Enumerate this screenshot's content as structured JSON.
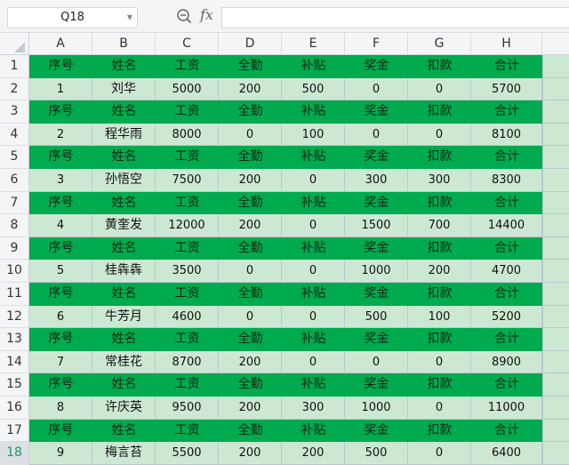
{
  "formula_bar": {
    "name_box": "Q18",
    "zoom_icon": "magnifier-zoom-icon",
    "fx_label": "fx",
    "formula_value": ""
  },
  "columns": [
    "A",
    "B",
    "C",
    "D",
    "E",
    "F",
    "G",
    "H"
  ],
  "row_numbers": [
    "1",
    "2",
    "3",
    "4",
    "5",
    "6",
    "7",
    "8",
    "9",
    "10",
    "11",
    "12",
    "13",
    "14",
    "15",
    "16",
    "17",
    "18"
  ],
  "active_row": "18",
  "header_labels": [
    "序号",
    "姓名",
    "工资",
    "全勤",
    "补贴",
    "奖金",
    "扣款",
    "合计"
  ],
  "records": [
    [
      "1",
      "刘华",
      "5000",
      "200",
      "500",
      "0",
      "0",
      "5700"
    ],
    [
      "2",
      "程华雨",
      "8000",
      "0",
      "100",
      "0",
      "0",
      "8100"
    ],
    [
      "3",
      "孙悟空",
      "7500",
      "200",
      "0",
      "300",
      "300",
      "8300"
    ],
    [
      "4",
      "黄奎发",
      "12000",
      "200",
      "0",
      "1500",
      "700",
      "14400"
    ],
    [
      "5",
      "桂犇犇",
      "3500",
      "0",
      "0",
      "1000",
      "200",
      "4700"
    ],
    [
      "6",
      "牛芳月",
      "4600",
      "0",
      "0",
      "500",
      "100",
      "5200"
    ],
    [
      "7",
      "常桂花",
      "8700",
      "200",
      "0",
      "0",
      "0",
      "8900"
    ],
    [
      "8",
      "许庆英",
      "9500",
      "200",
      "300",
      "1000",
      "0",
      "11000"
    ],
    [
      "9",
      "梅言苔",
      "5500",
      "200",
      "200",
      "500",
      "0",
      "6400"
    ]
  ],
  "colors": {
    "header_fill": "#00aa4f",
    "data_fill": "#cde8d2",
    "active_row_number": "#1a9c5c"
  }
}
